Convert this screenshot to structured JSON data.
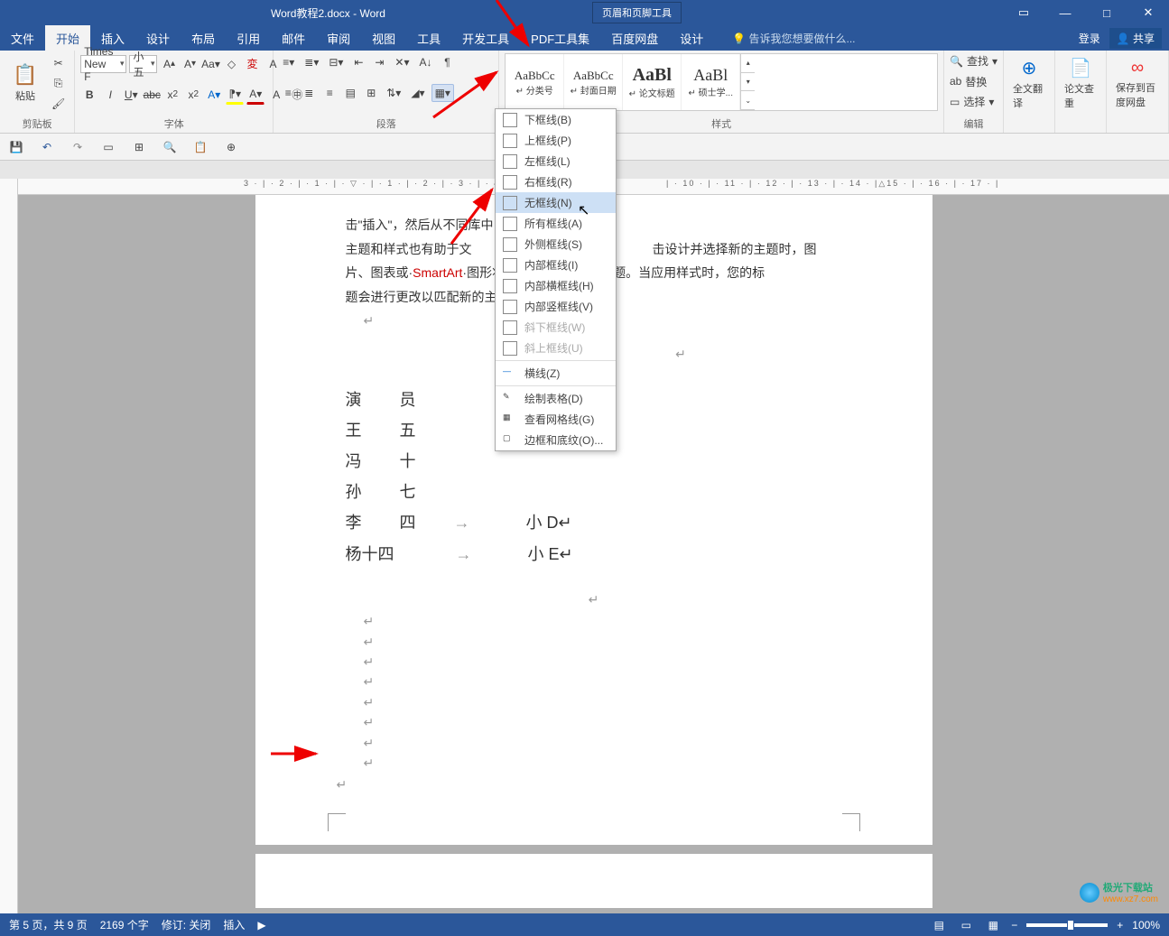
{
  "title": "Word教程2.docx - Word",
  "context_tool": "页眉和页脚工具",
  "context_tab": "设计",
  "tabs": [
    "文件",
    "开始",
    "插入",
    "设计",
    "布局",
    "引用",
    "邮件",
    "审阅",
    "视图",
    "工具",
    "开发工具",
    "PDF工具集",
    "百度网盘"
  ],
  "active_tab": "开始",
  "tellme": "告诉我您想要做什么...",
  "login": "登录",
  "share": "共享",
  "clipboard": {
    "paste": "粘贴",
    "label": "剪贴板"
  },
  "font": {
    "name": "Times New F",
    "size": "小五",
    "label": "字体"
  },
  "paragraph": {
    "label": "段落"
  },
  "styles": {
    "label": "样式",
    "items": [
      {
        "preview": "AaBbCc",
        "name": "↵ 分类号",
        "size": "13px"
      },
      {
        "preview": "AaBbCc",
        "name": "↵ 封面日期",
        "size": "13px"
      },
      {
        "preview": "AaBl",
        "name": "↵ 论文标题",
        "size": "20px",
        "bold": true
      },
      {
        "preview": "AaBl",
        "name": "↵ 硕士学...",
        "size": "18px"
      }
    ]
  },
  "editing": {
    "find": "查找",
    "replace": "替换",
    "select": "选择",
    "label": "编辑"
  },
  "fulltrans": {
    "label": "全文翻译"
  },
  "review": {
    "label": "论文查重"
  },
  "save": {
    "label": "保存到百度网盘"
  },
  "border_menu": {
    "items": [
      {
        "label": "下框线(B)",
        "icon": "b"
      },
      {
        "label": "上框线(P)",
        "icon": "t"
      },
      {
        "label": "左框线(L)",
        "icon": "l"
      },
      {
        "label": "右框线(R)",
        "icon": "r"
      },
      {
        "label": "无框线(N)",
        "icon": "n",
        "hov": true
      },
      {
        "label": "所有框线(A)",
        "icon": "a"
      },
      {
        "label": "外侧框线(S)",
        "icon": "o"
      },
      {
        "label": "内部框线(I)",
        "icon": "i"
      },
      {
        "label": "内部横框线(H)",
        "icon": "h"
      },
      {
        "label": "内部竖框线(V)",
        "icon": "v"
      },
      {
        "label": "斜下框线(W)",
        "icon": "d1",
        "dis": true
      },
      {
        "label": "斜上框线(U)",
        "icon": "d2",
        "dis": true
      }
    ],
    "extra": [
      {
        "label": "横线(Z)"
      },
      {
        "label": "绘制表格(D)"
      },
      {
        "label": "查看网格线(G)"
      },
      {
        "label": "边框和底纹(O)..."
      }
    ]
  },
  "document": {
    "para1": "击\"插入\"，然后从不同库中",
    "para2": "主题和样式也有助于文",
    "para2b": "击设计并选择新的主题时，图",
    "para3a": "片、图表或·",
    "smart": "SmartArt",
    "para3b": "·图形将",
    "para3c": "题。当应用样式时，您的标",
    "para4": "题会进行更改以匹配新的主题",
    "table": [
      [
        "演",
        "员",
        "",
        ""
      ],
      [
        "王",
        "五",
        "",
        ""
      ],
      [
        "冯",
        "十",
        "",
        ""
      ],
      [
        "孙",
        "七",
        "",
        ""
      ],
      [
        "李",
        "四",
        "→",
        "小  D↵"
      ],
      [
        "杨十四",
        "",
        "→",
        "小  E↵"
      ]
    ]
  },
  "status": {
    "page": "第 5 页，共 9 页",
    "words": "2169 个字",
    "track": "修订: 关闭",
    "insert": "插入",
    "zoom": "100%"
  },
  "watermark": {
    "text": "极光下载站",
    "url": "www.xz7.com"
  }
}
